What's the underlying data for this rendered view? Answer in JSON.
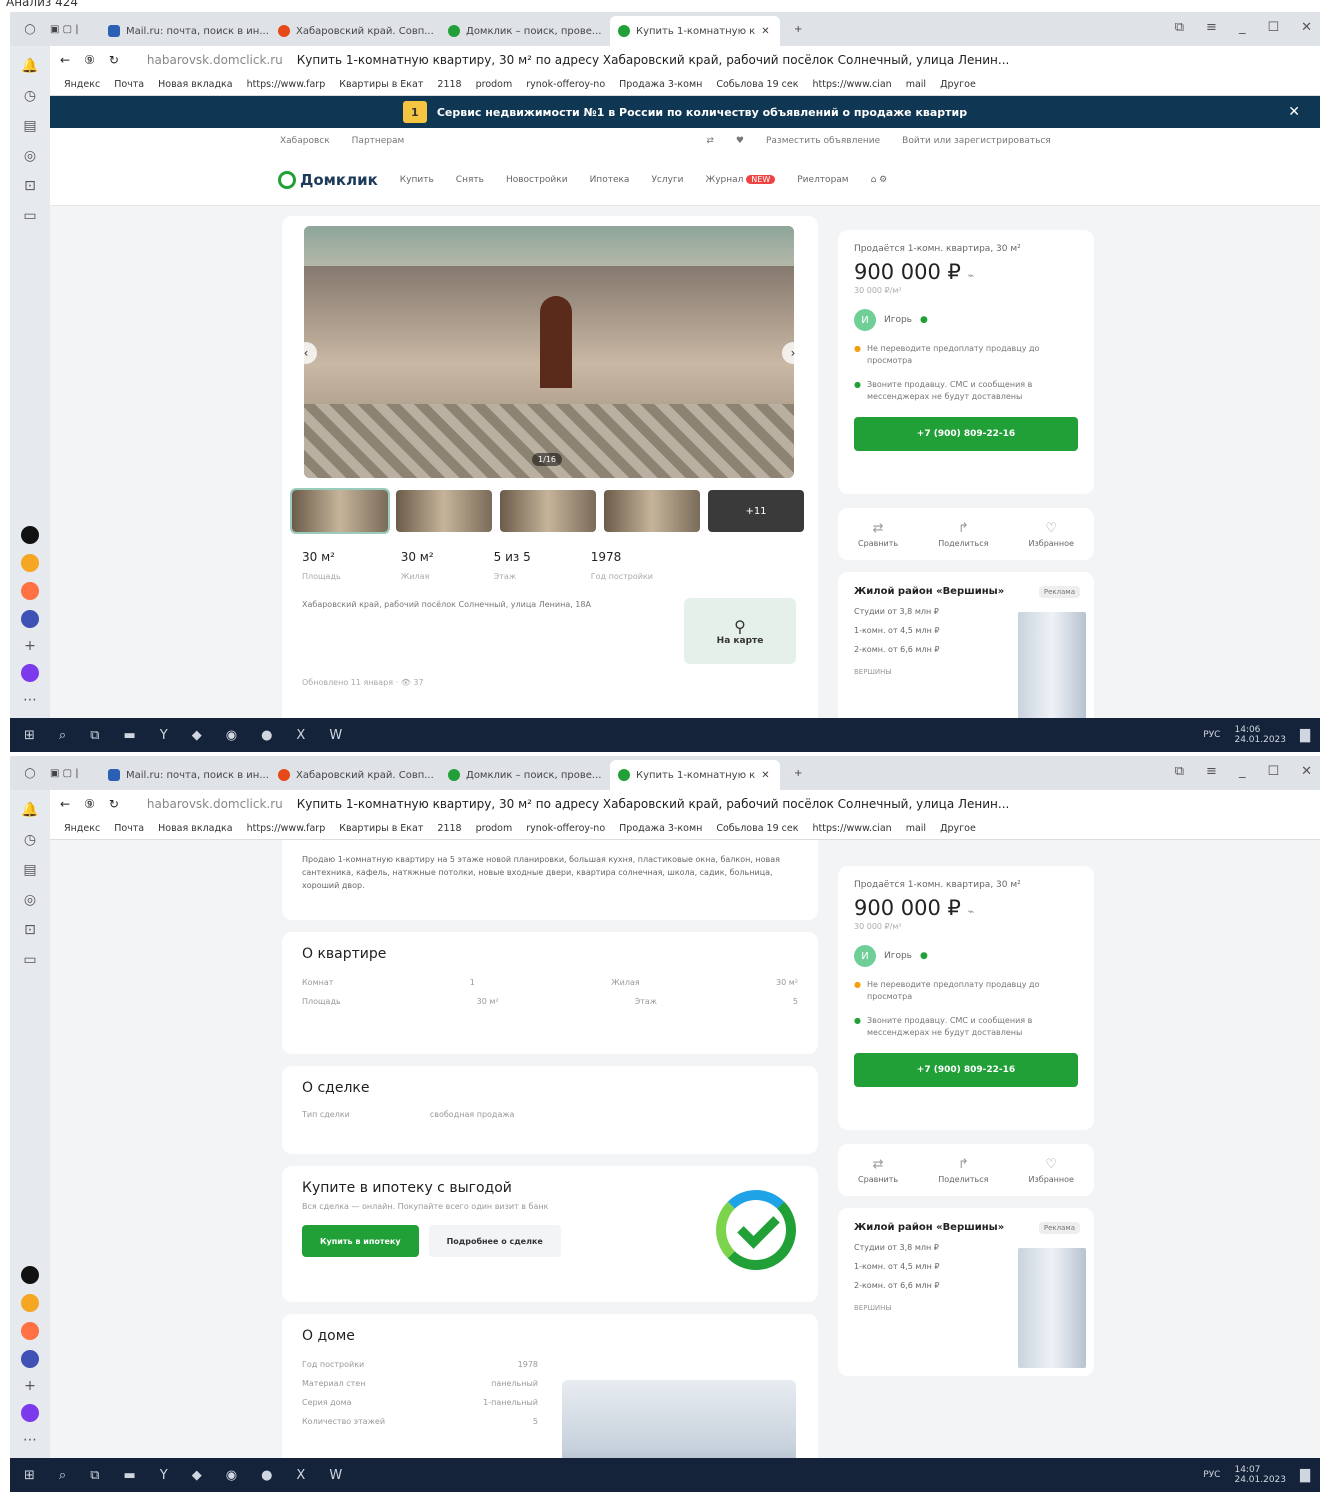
{
  "caption": "Анализ 424",
  "browser": {
    "tabs": [
      {
        "label": "Mail.ru: почта, поиск в ин...",
        "color": "#2b5fb3"
      },
      {
        "label": "Хабаровский край. Совп...",
        "color": "#e64a19"
      },
      {
        "label": "Домклик – поиск, прове...",
        "color": "#21a038"
      },
      {
        "label": "Купить 1-комнатную к",
        "color": "#21a038"
      }
    ],
    "url": "habarovsk.domclick.ru",
    "page_title": "Купить 1-комнатную квартиру, 30 м² по адресу Хабаровский край, рабочий посёлок Солнечный, улица Ленин...",
    "bookmarks": [
      "Яндекс",
      "Почта",
      "Новая вкладка",
      "https://www.farp",
      "Квартиры в Екат",
      "2118",
      "prodom",
      "rynok-offeroy-no",
      "Продажа 3-комн",
      "Собьлова 19 сек",
      "https://www.cian",
      "mail",
      "Другое"
    ]
  },
  "banner": {
    "badge": "1",
    "text": "Сервис недвижимости №1 в России по количеству объявлений о продаже квартир"
  },
  "topmenu": {
    "city": "Хабаровск",
    "partners": "Партнерам",
    "post": "Разместить объявление",
    "login": "Войти или зарегистрироваться"
  },
  "nav": {
    "logo": "Домклик",
    "items": [
      "Купить",
      "Снять",
      "Новостройки",
      "Ипотека",
      "Услуги",
      "Журнал",
      "Риелторам"
    ],
    "badge": "NEW"
  },
  "photo": {
    "counter": "1/16",
    "more": "+11"
  },
  "facts": [
    {
      "value": "30 м²",
      "label": "Площадь"
    },
    {
      "value": "30 м²",
      "label": "Жилая"
    },
    {
      "value": "5 из 5",
      "label": "Этаж"
    },
    {
      "value": "1978",
      "label": "Год постройки"
    }
  ],
  "address": "Хабаровский край, рабочий посёлок Солнечный, улица Ленина, 18А",
  "map_label": "На карте",
  "views": "Обновлено 11 января",
  "views_count": "37",
  "price": {
    "title": "Продаётся 1-комн. квартира, 30 м²",
    "value": "900 000 ₽",
    "per_m": "30 000 ₽/м²",
    "agent_initial": "И",
    "agent": "Игорь",
    "warn1": "Не переводите предоплату продавцу до просмотра",
    "warn2": "Звоните продавцу. СМС и сообщения в мессенджерах не будут доставлены",
    "phone": "+7 (900) 809-22-16"
  },
  "actions": [
    {
      "icon": "⇄",
      "label": "Сравнить"
    },
    {
      "icon": "↱",
      "label": "Поделиться"
    },
    {
      "icon": "♡",
      "label": "Избранное"
    }
  ],
  "promo": {
    "title": "Жилой район «Вершины»",
    "tag": "Реклама",
    "lines": [
      "Студии от 3,8 млн ₽",
      "1-комн. от 4,5 млн ₽",
      "2-комн. от 6,6 млн ₽"
    ],
    "logo": "ВЕРШИНЫ"
  },
  "taskbar": {
    "time1": "14:06",
    "time2": "14:07",
    "date": "24.01.2023",
    "lang": "РУС"
  },
  "description_text": "Продаю 1-комнатную квартиру на 5 этаже новой планировки, большая кухня, пластиковые окна, балкон, новая сантехника, кафель, натяжные потолки, новые входные двери, квартира солнечная, школа, садик, больница, хороший двор.",
  "about_flat": {
    "title": "О квартире",
    "rows": [
      {
        "k1": "Комнат",
        "v1": "1",
        "k2": "Жилая",
        "v2": "30 м²"
      },
      {
        "k1": "Площадь",
        "v1": "30 м²",
        "k2": "Этаж",
        "v2": "5"
      }
    ]
  },
  "deal": {
    "title": "О сделке",
    "k": "Тип сделки",
    "v": "свободная продажа"
  },
  "mortgage": {
    "title": "Купите в ипотеку с выгодой",
    "sub": "Вся сделка — онлайн. Покупайте всего один визит в банк",
    "btn1": "Купить в ипотеку",
    "btn2": "Подробнее о сделке"
  },
  "house": {
    "title": "О доме",
    "rows": [
      {
        "k": "Год постройки",
        "v": "1978"
      },
      {
        "k": "Материал стен",
        "v": "панельный"
      },
      {
        "k": "Серия дома",
        "v": "1-панельный"
      },
      {
        "k": "Количество этажей",
        "v": "5"
      }
    ]
  }
}
